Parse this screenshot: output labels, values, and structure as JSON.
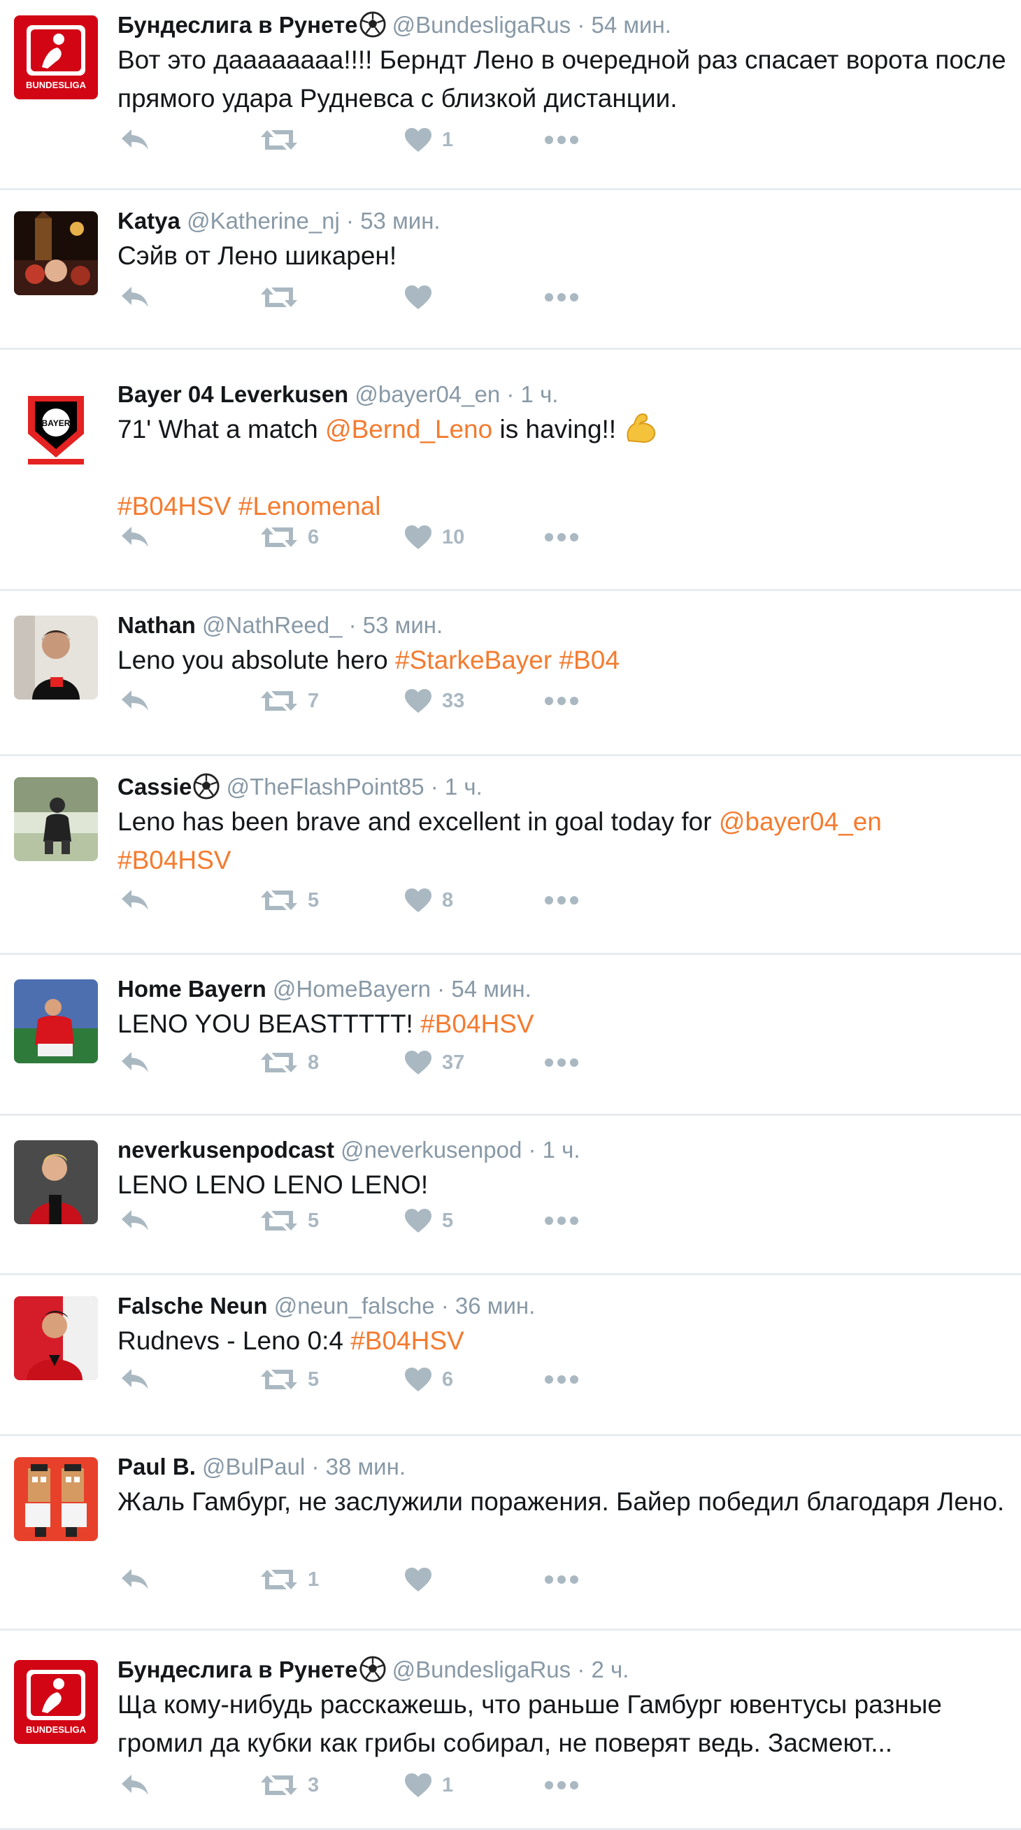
{
  "colors": {
    "accent": "#f47b2f",
    "muted": "#8899a6",
    "icon": "#aab8c2",
    "divider": "#e6ecf0"
  },
  "icons": {
    "reply": "reply-icon",
    "retweet": "retweet-icon",
    "like": "heart-icon",
    "more": "more-icon",
    "soccer": "soccer-ball-icon",
    "flex": "flexed-biceps-icon"
  },
  "tweets": [
    {
      "name": "Бундеслига в Рунете",
      "name_icon": "soccer-ball-icon",
      "handle": "@BundesligaRus",
      "time": "54 мин.",
      "text": [
        {
          "t": "Вот это даааааааа!!!! Берндт Лено в очередной раз спасает ворота после прямого удара Рудневса с близкой дистанции."
        }
      ],
      "retweets": "",
      "likes": "1",
      "avatar": "bundesliga-logo"
    },
    {
      "name": "Katya",
      "handle": "@Katherine_nj",
      "time": "53 мин.",
      "text": [
        {
          "t": "Сэйв от Лено шикарен!"
        }
      ],
      "retweets": "",
      "likes": "",
      "avatar": "photo-night-city"
    },
    {
      "name": "Bayer 04 Leverkusen",
      "handle": "@bayer04_en",
      "time": "1 ч.",
      "text": [
        {
          "t": "71' What a match "
        },
        {
          "t": "@Bernd_Leno",
          "hl": true
        },
        {
          "t": " is having!! "
        },
        {
          "emoji": "flexed-biceps-icon"
        },
        {
          "t": "\n\n"
        },
        {
          "t": "#B04HSV",
          "hl": true
        },
        {
          "t": " "
        },
        {
          "t": "#Lenomenal",
          "hl": true
        }
      ],
      "retweets": "6",
      "likes": "10",
      "avatar": "bayer-crest"
    },
    {
      "name": "Nathan",
      "handle": "@NathReed_",
      "time": "53 мин.",
      "text": [
        {
          "t": "Leno you absolute hero "
        },
        {
          "t": "#StarkeBayer",
          "hl": true
        },
        {
          "t": " "
        },
        {
          "t": "#B04",
          "hl": true
        }
      ],
      "retweets": "7",
      "likes": "33",
      "avatar": "photo-selfie"
    },
    {
      "name": "Cassie",
      "name_icon": "soccer-ball-icon",
      "handle": "@TheFlashPoint85",
      "time": "1 ч.",
      "text": [
        {
          "t": "Leno has been brave and excellent in goal today for "
        },
        {
          "t": "@bayer04_en",
          "hl": true
        },
        {
          "t": "\n"
        },
        {
          "t": "#B04HSV",
          "hl": true
        }
      ],
      "retweets": "5",
      "likes": "8",
      "avatar": "photo-outdoor"
    },
    {
      "name": "Home Bayern",
      "handle": "@HomeBayern",
      "time": "54 мин.",
      "text": [
        {
          "t": "LENO YOU BEASTTTTT! "
        },
        {
          "t": "#B04HSV",
          "hl": true
        }
      ],
      "retweets": "8",
      "likes": "37",
      "avatar": "photo-player-red"
    },
    {
      "name": "neverkusenpodcast",
      "handle": "@neverkusenpod",
      "time": "1 ч.",
      "text": [
        {
          "t": "LENO LENO LENO LENO!"
        }
      ],
      "retweets": "5",
      "likes": "5",
      "avatar": "photo-player"
    },
    {
      "name": "Falsche Neun",
      "handle": "@neun_falsche",
      "time": "36 мин.",
      "text": [
        {
          "t": "Rudnevs - Leno 0:4 "
        },
        {
          "t": "#B04HSV",
          "hl": true
        }
      ],
      "retweets": "5",
      "likes": "6",
      "avatar": "photo-player-jersey"
    },
    {
      "name": "Paul B.",
      "handle": "@BulPaul",
      "time": "38 мин.",
      "text": [
        {
          "t": "Жаль Гамбург, не заслужили поражения. Байер победил благодаря Лено."
        }
      ],
      "retweets": "1",
      "likes": "",
      "avatar": "pixel-art"
    },
    {
      "name": "Бундеслига в Рунете",
      "name_icon": "soccer-ball-icon",
      "handle": "@BundesligaRus",
      "time": "2 ч.",
      "text": [
        {
          "t": "Ща кому-нибудь расскажешь, что раньше Гамбург ювентусы разные громил да кубки как грибы собирал, не поверят ведь. Засмеют..."
        }
      ],
      "retweets": "3",
      "likes": "1",
      "avatar": "bundesliga-logo"
    }
  ]
}
